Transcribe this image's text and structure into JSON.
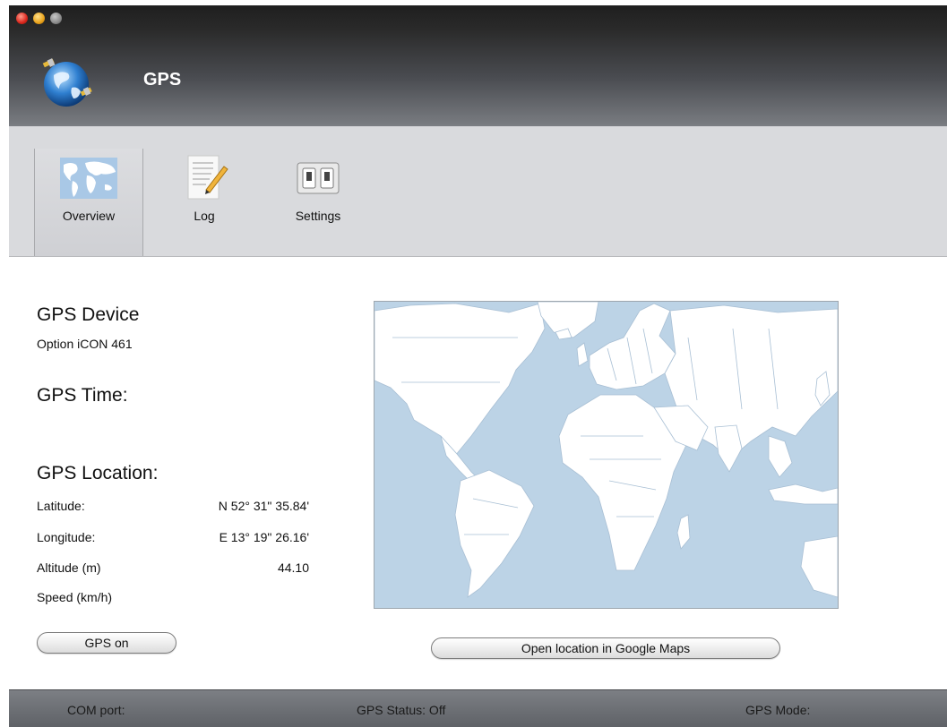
{
  "window": {
    "title": "GPS"
  },
  "toolbar": {
    "tabs": [
      {
        "label": "Overview",
        "icon": "world-map-icon",
        "active": true
      },
      {
        "label": "Log",
        "icon": "log-document-icon",
        "active": false
      },
      {
        "label": "Settings",
        "icon": "switches-icon",
        "active": false
      }
    ]
  },
  "device": {
    "heading": "GPS Device",
    "name": "Option iCON 461"
  },
  "time": {
    "heading": "GPS Time:"
  },
  "location": {
    "heading": "GPS Location:",
    "rows": [
      {
        "label": "Latitude:",
        "value": "N 52° 31\" 35.84'"
      },
      {
        "label": "Longitude:",
        "value": "E 13° 19\" 26.16'"
      },
      {
        "label": "Altitude (m)",
        "value": "44.10"
      },
      {
        "label": "Speed (km/h)",
        "value": ""
      }
    ]
  },
  "buttons": {
    "gps_toggle": "GPS on",
    "open_maps": "Open location in Google Maps"
  },
  "statusbar": {
    "com_port": "COM port:",
    "gps_status": "GPS Status:  Off",
    "gps_mode": "GPS Mode:"
  },
  "colors": {
    "ocean": "#bcd3e6",
    "land": "#ffffff",
    "statusbar": "#6b6e73"
  }
}
